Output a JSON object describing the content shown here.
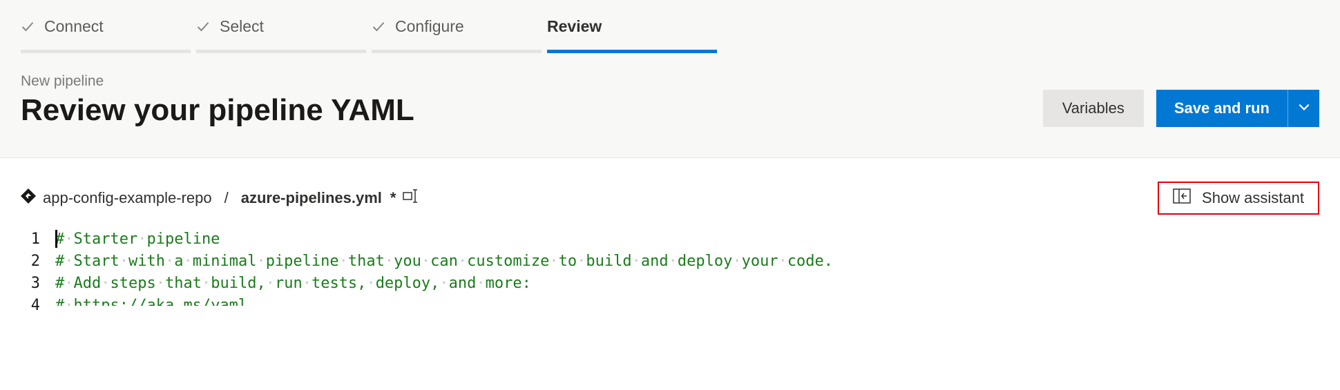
{
  "stepper": {
    "tabs": [
      {
        "label": "Connect",
        "done": true,
        "active": false
      },
      {
        "label": "Select",
        "done": true,
        "active": false
      },
      {
        "label": "Configure",
        "done": true,
        "active": false
      },
      {
        "label": "Review",
        "done": false,
        "active": true
      }
    ]
  },
  "header": {
    "subtitle": "New pipeline",
    "title": "Review your pipeline YAML",
    "variables_label": "Variables",
    "save_run_label": "Save and run"
  },
  "file": {
    "repo": "app-config-example-repo",
    "separator": "/",
    "name": "azure-pipelines.yml",
    "dirty": "*"
  },
  "assistant": {
    "label": "Show assistant"
  },
  "code": {
    "lines": [
      "# Starter pipeline",
      "# Start with a minimal pipeline that you can customize to build and deploy your code.",
      "# Add steps that build, run tests, deploy, and more:",
      "# https://aka.ms/yaml"
    ]
  }
}
